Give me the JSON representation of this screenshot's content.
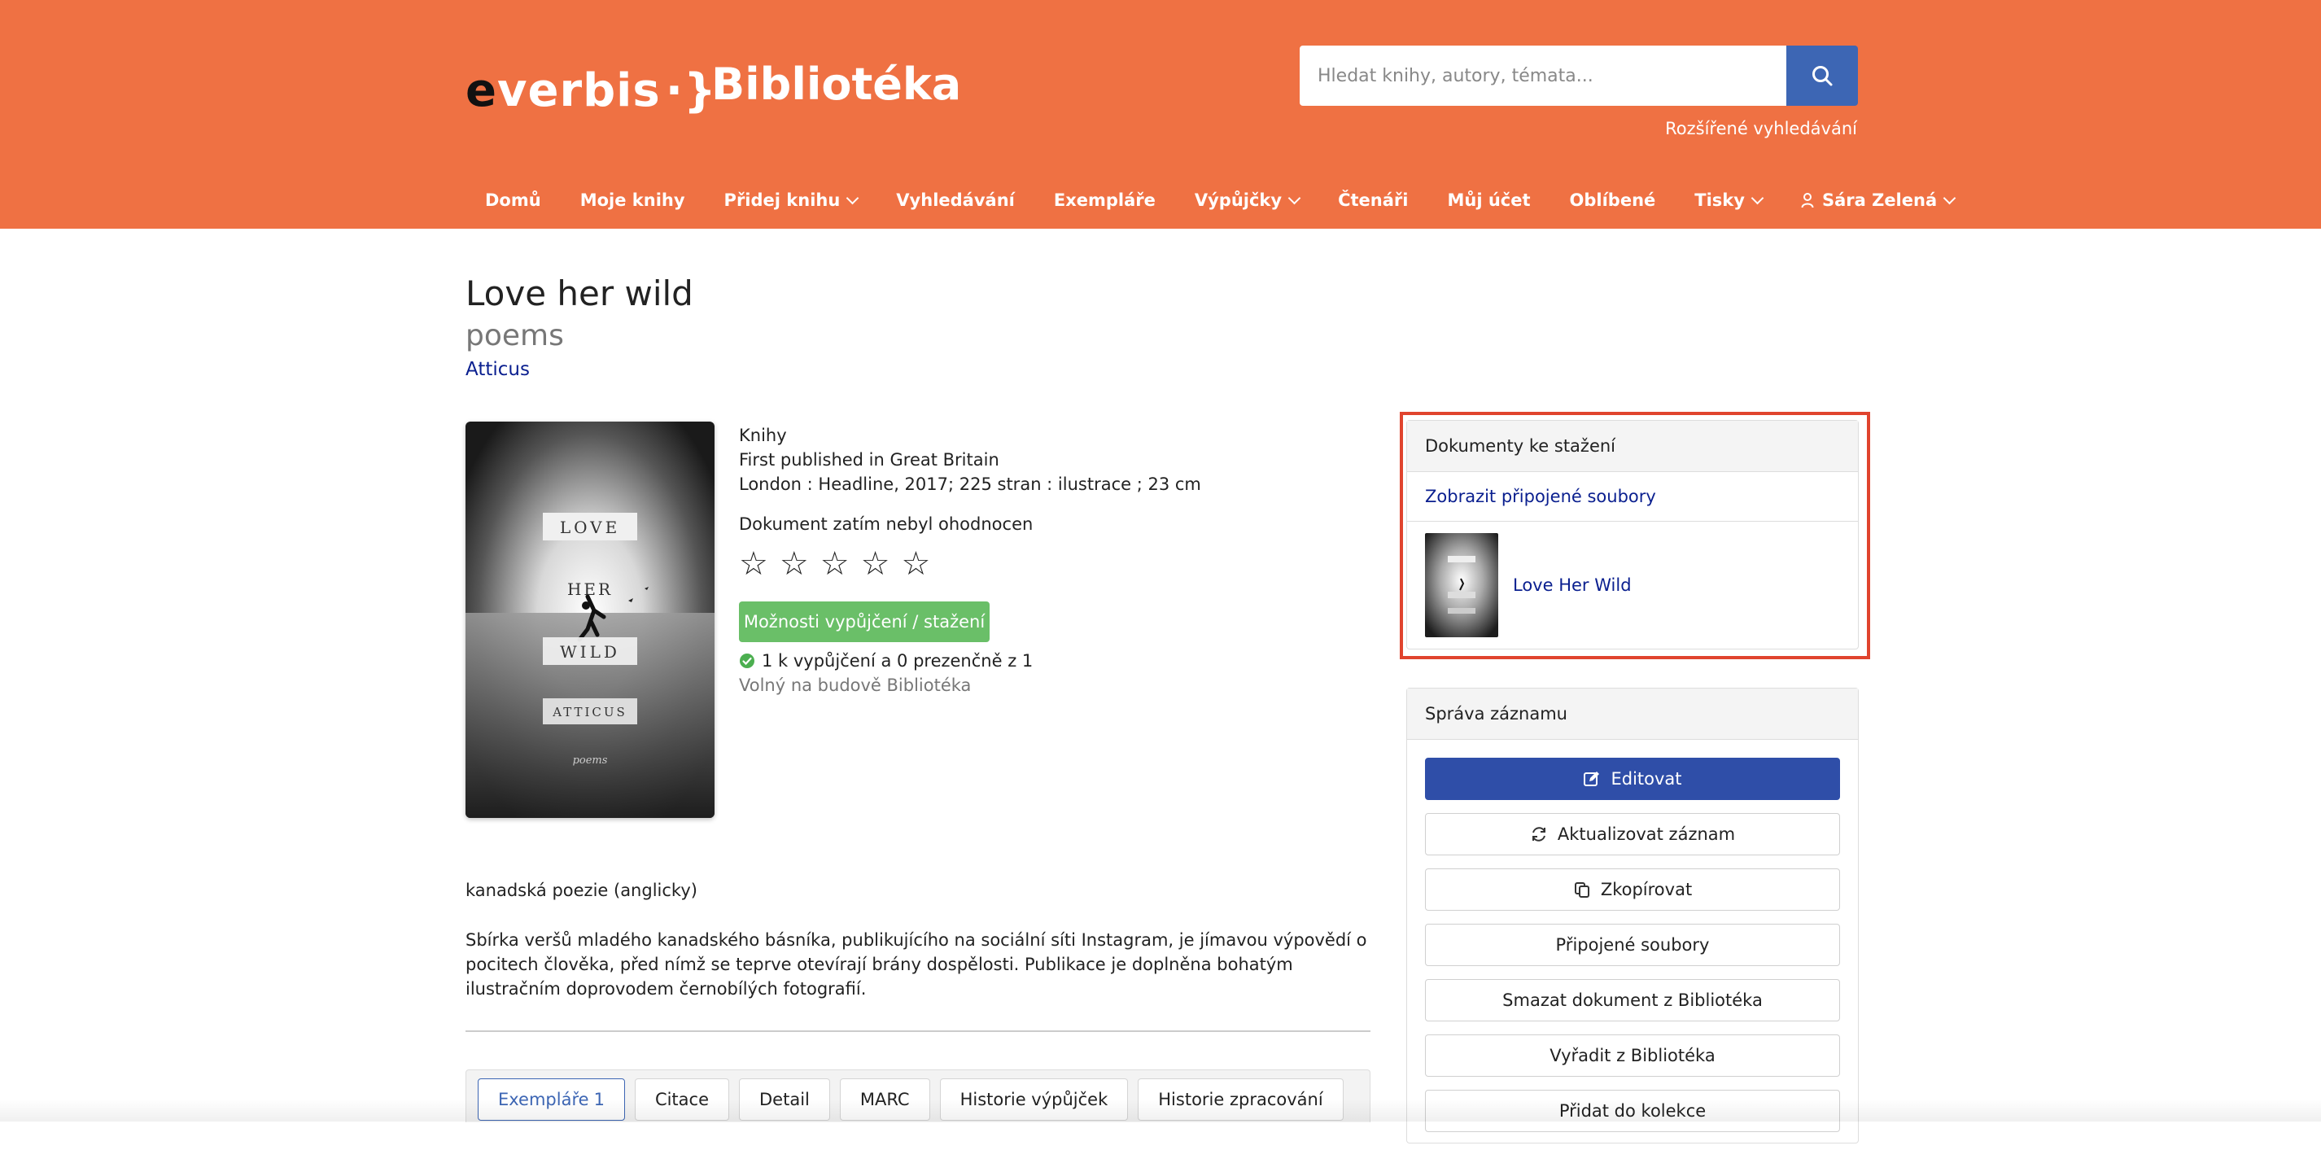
{
  "header": {
    "logo_e": "e",
    "logo_rest": "verbis",
    "logo_brace": "·}",
    "site_title": "Bibliotéka",
    "search_placeholder": "Hledat knihy, autory, témata...",
    "advanced_search": "Rozšířené vyhledávání",
    "accent_color": "#ef7143"
  },
  "nav": {
    "items": [
      {
        "label": "Domů"
      },
      {
        "label": "Moje knihy"
      },
      {
        "label": "Přidej knihu"
      },
      {
        "label": "Vyhledávání"
      },
      {
        "label": "Exempláře"
      },
      {
        "label": "Výpůjčky"
      },
      {
        "label": "Čtenáři"
      },
      {
        "label": "Můj účet"
      },
      {
        "label": "Oblíbené"
      },
      {
        "label": "Tisky"
      }
    ],
    "user": "Sára Zelená"
  },
  "book": {
    "title": "Love her wild",
    "subtitle": "poems",
    "author": "Atticus",
    "cover_texts": [
      "LOVE",
      "HER",
      "WILD",
      "ATTICUS",
      "poems"
    ],
    "type": "Knihy",
    "edition": "First published in Great Britain",
    "publication": "London : Headline, 2017; 225 stran : ilustrace ; 23 cm",
    "rating_label": "Dokument zatím nebyl ohodnocen",
    "rating_stars": 0,
    "rating_max": 5,
    "loan_button": "Možnosti vypůjčení / stažení",
    "availability": "1 k vypůjčení a 0 prezenčně z 1",
    "location": "Volný na budově Bibliotéka",
    "subject": "kanadská poezie (anglicky)",
    "annotation": "Sbírka veršů mladého kanadského básníka, publikujícího na sociální síti Instagram, je jímavou výpovědí o pocitech člověka, před nímž se teprve otevírají brány dospělosti. Publikace je doplněna bohatým ilustračním doprovodem černobílých fotografií."
  },
  "tabs": [
    {
      "label": "Exempláře",
      "count": "1"
    },
    {
      "label": "Citace"
    },
    {
      "label": "Detail"
    },
    {
      "label": "MARC"
    },
    {
      "label": "Historie výpůjček"
    },
    {
      "label": "Historie zpracování"
    }
  ],
  "downloads": {
    "title": "Dokumenty ke stažení",
    "show_link": "Zobrazit připojené soubory",
    "file_name": "Love Her Wild"
  },
  "manage": {
    "title": "Správa záznamu",
    "buttons": [
      {
        "label": "Editovat"
      },
      {
        "label": "Aktualizovat záznam"
      },
      {
        "label": "Zkopírovat"
      },
      {
        "label": "Připojené soubory"
      },
      {
        "label": "Smazat dokument z Bibliotéka"
      },
      {
        "label": "Vyřadit z Bibliotéka"
      },
      {
        "label": "Přidat do kolekce"
      }
    ]
  }
}
